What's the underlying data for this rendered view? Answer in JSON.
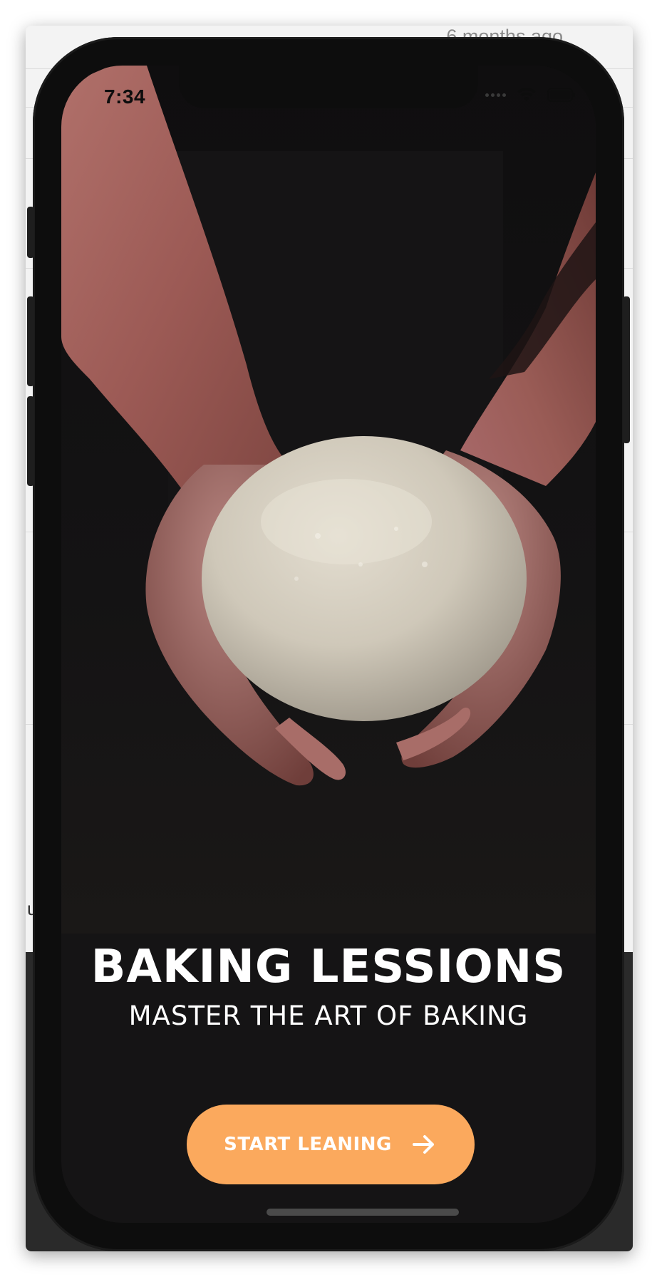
{
  "background_window": {
    "timestamp": "6 months ago",
    "stub_letter": "u"
  },
  "status_bar": {
    "time": "7:34",
    "icons": [
      "signal-dots-icon",
      "wifi-icon",
      "battery-icon"
    ]
  },
  "hero": {
    "icon": "hands-holding-dough-photo"
  },
  "content": {
    "title": "BAKING LESSIONS",
    "subtitle": "MASTER THE ART OF BAKING"
  },
  "cta": {
    "label": "START LEANING",
    "icon": "arrow-right-icon"
  },
  "colors": {
    "accent": "#fba95d",
    "screen_bg": "#151415",
    "text": "#ffffff",
    "frame": "#0d0d0d"
  }
}
